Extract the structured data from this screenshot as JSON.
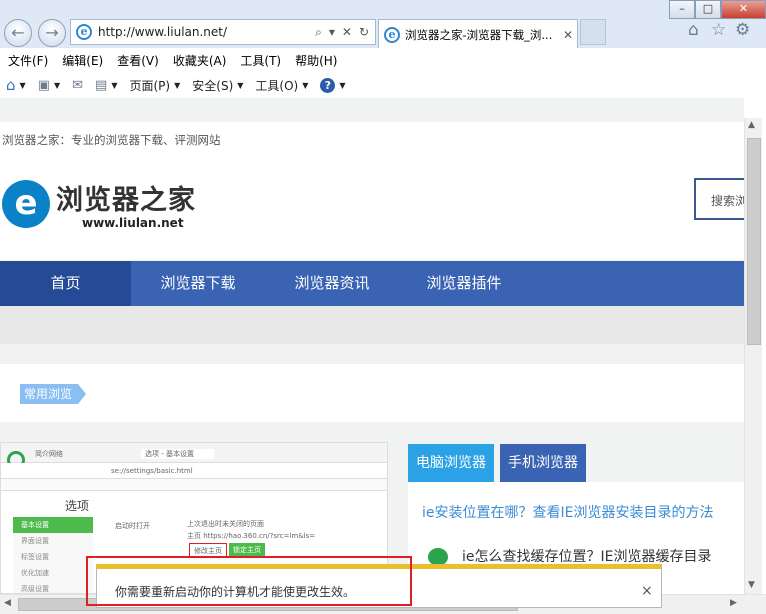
{
  "window": {
    "min": "–",
    "max": "□",
    "close": "✕"
  },
  "address_bar": {
    "url": "http://www.liulan.net/",
    "icons": [
      "⌕",
      "▾",
      "✕",
      "↻"
    ]
  },
  "tab": {
    "title": "浏览器之家-浏览器下载_浏...",
    "close": "✕"
  },
  "right_icons": {
    "home": "⌂",
    "favorites": "☆",
    "settings": "⚙"
  },
  "menu_bar": [
    "文件(F)",
    "编辑(E)",
    "查看(V)",
    "收藏夹(A)",
    "工具(T)",
    "帮助(H)"
  ],
  "command_bar": {
    "page": "页面(P)",
    "safety": "安全(S)",
    "tools": "工具(O)",
    "help": "?"
  },
  "site": {
    "slogan": "浏览器之家：专业的浏览器下载、评测网站",
    "logo_mark": "e",
    "logo_text": "浏览器之家",
    "logo_url": "www.liulan.net",
    "search_placeholder": "搜索浏",
    "nav": [
      "首页",
      "浏览器下载",
      "浏览器资讯",
      "浏览器插件"
    ],
    "section_label": "常用浏览",
    "right_tabs": [
      "电脑浏览器",
      "手机浏览器"
    ],
    "articles": [
      "ie安装位置在哪？查看IE浏览器安装目录的方法",
      "ie怎么查找缓存位置？IE浏览器缓存目录"
    ]
  },
  "embedded_screenshot": {
    "tab1": "简介网络",
    "tab2": "选项 - 基本设置",
    "url": "se://settings/basic.html",
    "heading": "选项",
    "sidebar": [
      "基本设置",
      "界面设置",
      "标签设置",
      "优化加速",
      "高级设置"
    ],
    "startup_label": "启动时打开",
    "option1": "上次退出时未关闭的页面",
    "option2": "主页 https://hao.360.cn/?src=lm&ls=",
    "btn_modify": "修改主页",
    "btn_lock": "锁定主页"
  },
  "notification": {
    "text": "你需要重新启动你的计算机才能使更改生效。",
    "close": "×"
  },
  "colors": {
    "nav_bg": "#3b63b4",
    "nav_active": "#254b97",
    "tab_active": "#2ba2e6",
    "tab_inactive": "#3b63b4",
    "highlight": "#e02020",
    "notif_bar": "#e9bf2e"
  }
}
